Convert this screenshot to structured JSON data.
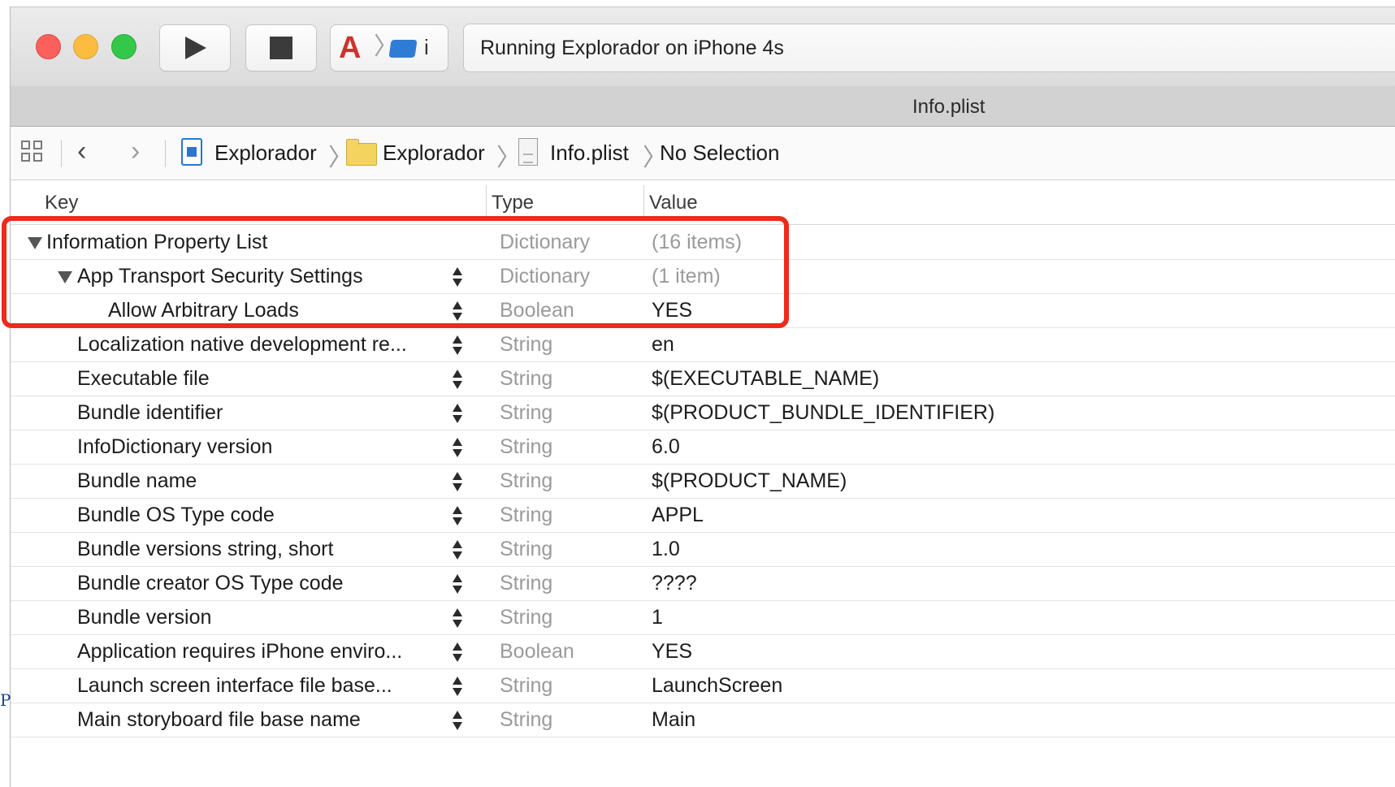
{
  "toolbar": {
    "run_icon": "play-icon",
    "stop_icon": "stop-icon",
    "scheme_trailing_text": "i",
    "activity_text": "Running Explorador on iPhone 4s"
  },
  "tab": {
    "title": "Info.plist"
  },
  "jumpbar": {
    "crumbs": [
      "Explorador",
      "Explorador",
      "Info.plist",
      "No Selection"
    ]
  },
  "table": {
    "headers": {
      "key": "Key",
      "type": "Type",
      "value": "Value"
    },
    "rows": [
      {
        "key": "Information Property List",
        "type": "Dictionary",
        "value": "(16 items)"
      },
      {
        "key": "App Transport Security Settings",
        "type": "Dictionary",
        "value": "(1 item)"
      },
      {
        "key": "Allow Arbitrary Loads",
        "type": "Boolean",
        "value": "YES"
      },
      {
        "key": "Localization native development re...",
        "type": "String",
        "value": "en"
      },
      {
        "key": "Executable file",
        "type": "String",
        "value": "$(EXECUTABLE_NAME)"
      },
      {
        "key": "Bundle identifier",
        "type": "String",
        "value": "$(PRODUCT_BUNDLE_IDENTIFIER)"
      },
      {
        "key": "InfoDictionary version",
        "type": "String",
        "value": "6.0"
      },
      {
        "key": "Bundle name",
        "type": "String",
        "value": "$(PRODUCT_NAME)"
      },
      {
        "key": "Bundle OS Type code",
        "type": "String",
        "value": "APPL"
      },
      {
        "key": "Bundle versions string, short",
        "type": "String",
        "value": "1.0"
      },
      {
        "key": "Bundle creator OS Type code",
        "type": "String",
        "value": "????"
      },
      {
        "key": "Bundle version",
        "type": "String",
        "value": "1"
      },
      {
        "key": "Application requires iPhone enviro...",
        "type": "Boolean",
        "value": "YES"
      },
      {
        "key": "Launch screen interface file base...",
        "type": "String",
        "value": "LaunchScreen"
      },
      {
        "key": "Main storyboard file base name",
        "type": "String",
        "value": "Main"
      }
    ]
  },
  "annotation": {
    "color": "#ee2a1a"
  },
  "stray_text": "P"
}
